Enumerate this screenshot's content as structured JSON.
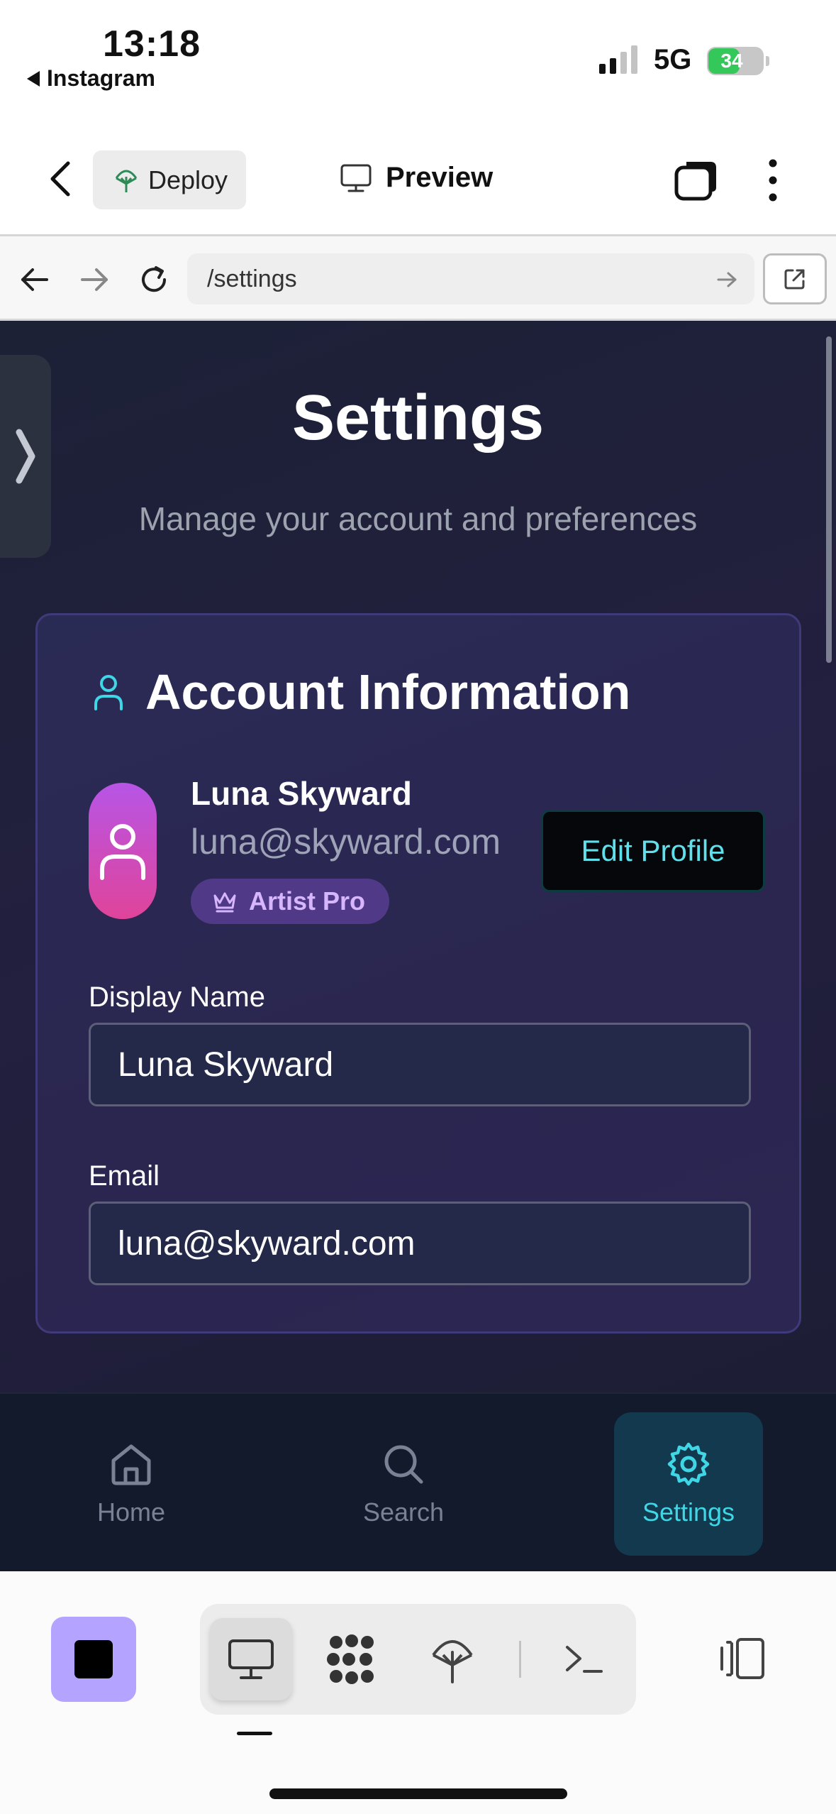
{
  "status_bar": {
    "time": "13:18",
    "back_app": "Instagram",
    "network": "5G",
    "battery": "34"
  },
  "toolbar": {
    "deploy_label": "Deploy",
    "preview_label": "Preview"
  },
  "browser": {
    "url": "/settings"
  },
  "page": {
    "title": "Settings",
    "subtitle": "Manage your account and preferences"
  },
  "account": {
    "section_title": "Account Information",
    "name": "Luna Skyward",
    "email": "luna@skyward.com",
    "plan": "Artist Pro",
    "edit_label": "Edit Profile",
    "display_name_label": "Display Name",
    "display_name_value": "Luna Skyward",
    "email_label": "Email",
    "email_value": "luna@skyward.com"
  },
  "bottom_nav": {
    "items": [
      {
        "label": "Home",
        "icon": "home-icon",
        "active": false
      },
      {
        "label": "Search",
        "icon": "search-icon",
        "active": false
      },
      {
        "label": "Settings",
        "icon": "gear-icon",
        "active": true
      }
    ]
  },
  "colors": {
    "accent": "#3fd6e6",
    "badge": "#d7b6ff",
    "stop_button": "#b4a4ff",
    "battery_green": "#34c759"
  }
}
